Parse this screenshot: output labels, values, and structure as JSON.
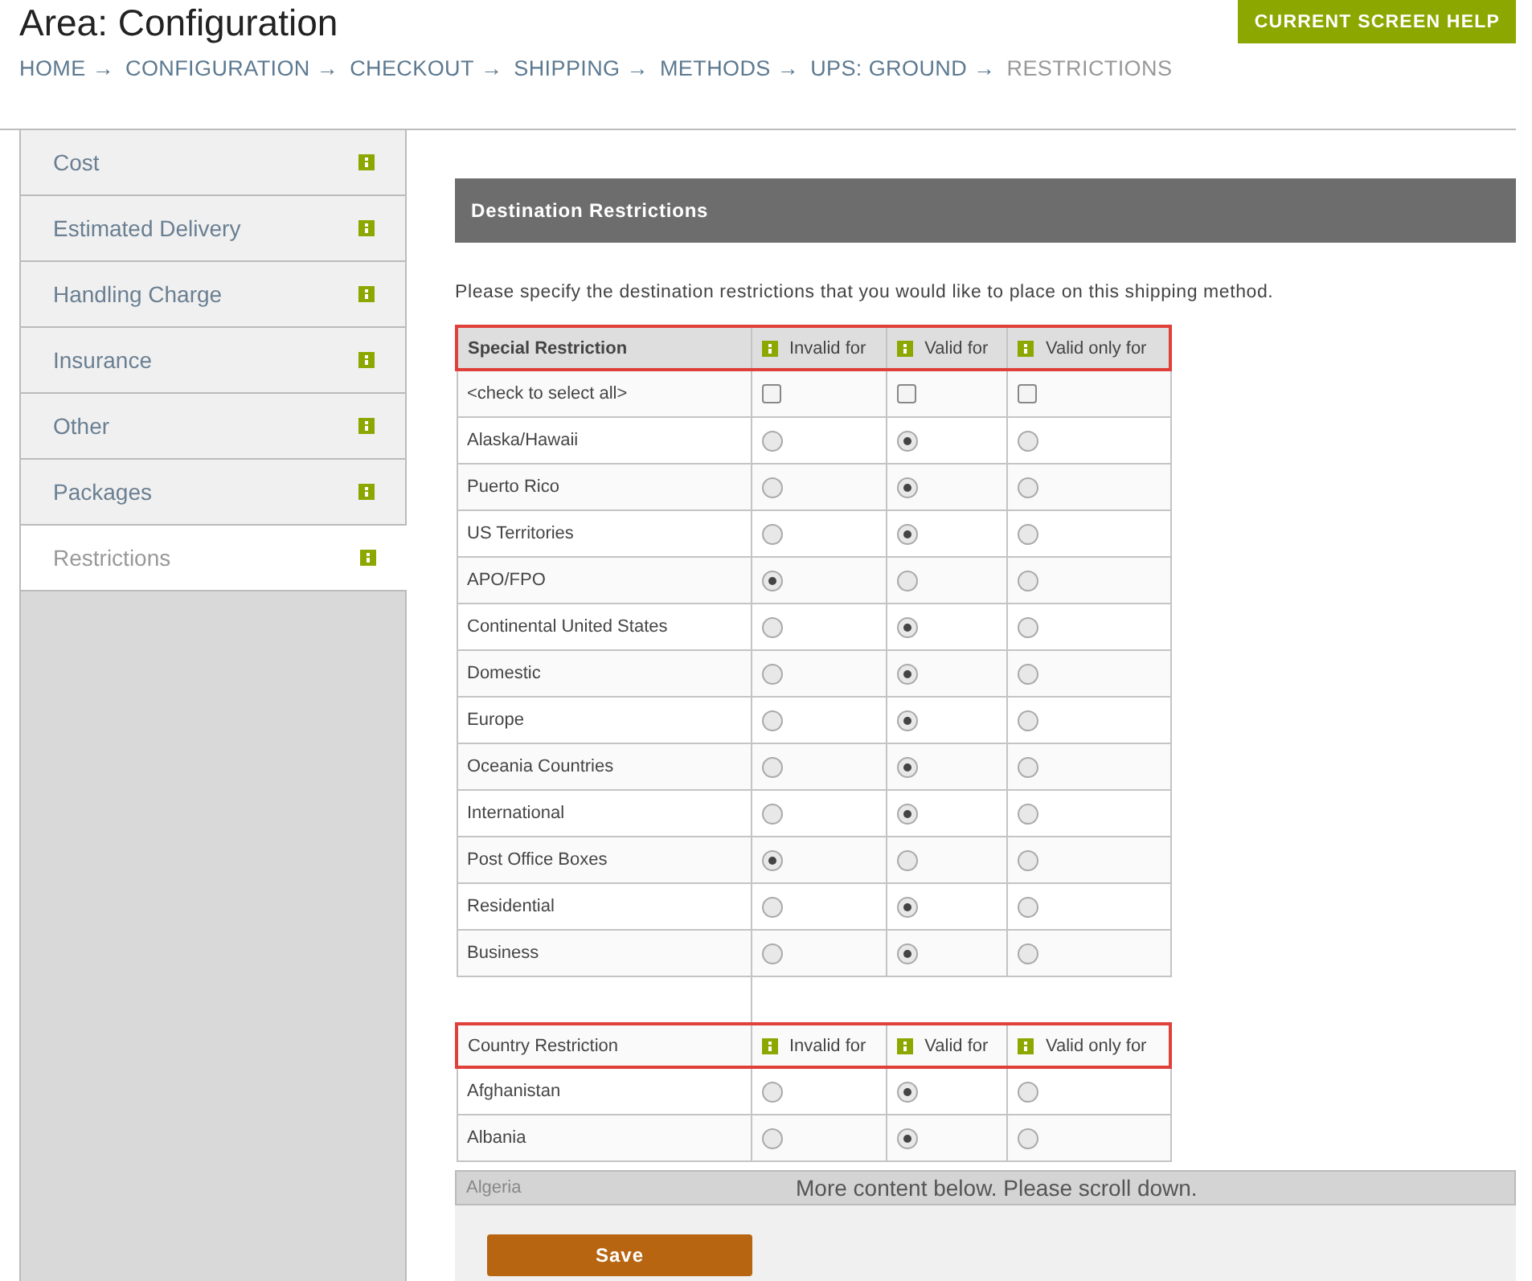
{
  "header": {
    "title": "Area: Configuration",
    "help_button": "CURRENT SCREEN HELP"
  },
  "breadcrumb": [
    {
      "label": "HOME",
      "arrow": "→",
      "current": false
    },
    {
      "label": "CONFIGURATION",
      "arrow": "→",
      "current": false
    },
    {
      "label": "CHECKOUT",
      "arrow": "→",
      "current": false
    },
    {
      "label": "SHIPPING",
      "arrow": "→",
      "current": false
    },
    {
      "label": "METHODS",
      "arrow": "→",
      "current": false
    },
    {
      "label": "UPS: GROUND",
      "arrow": "→",
      "current": false
    },
    {
      "label": "RESTRICTIONS",
      "current": true
    }
  ],
  "sidebar": {
    "items": [
      {
        "label": "Cost",
        "selected": false
      },
      {
        "label": "Estimated Delivery",
        "selected": false
      },
      {
        "label": "Handling Charge",
        "selected": false
      },
      {
        "label": "Insurance",
        "selected": false
      },
      {
        "label": "Other",
        "selected": false
      },
      {
        "label": "Packages",
        "selected": false
      },
      {
        "label": "Restrictions",
        "selected": true
      }
    ]
  },
  "panel": {
    "title": "Destination Restrictions",
    "instructions": "Please specify the destination restrictions that you would like to place on this shipping method."
  },
  "tables": [
    {
      "heading": "Special Restriction",
      "columns": [
        "Invalid for",
        "Valid for",
        "Valid only for"
      ],
      "select_all": {
        "label": "<check to select all>",
        "checked": [
          false,
          false,
          false
        ]
      },
      "rows": [
        {
          "label": "Alaska/Hawaii",
          "radios": [
            false,
            true,
            false
          ]
        },
        {
          "label": "Puerto Rico",
          "radios": [
            false,
            true,
            false
          ]
        },
        {
          "label": "US Territories",
          "radios": [
            false,
            true,
            false
          ]
        },
        {
          "label": "APO/FPO",
          "radios": [
            true,
            false,
            false
          ]
        },
        {
          "label": "Continental United States",
          "radios": [
            false,
            true,
            false
          ]
        },
        {
          "label": "Domestic",
          "radios": [
            false,
            true,
            false
          ]
        },
        {
          "label": "Europe",
          "radios": [
            false,
            true,
            false
          ]
        },
        {
          "label": "Oceania Countries",
          "radios": [
            false,
            true,
            false
          ]
        },
        {
          "label": "International",
          "radios": [
            false,
            true,
            false
          ]
        },
        {
          "label": "Post Office Boxes",
          "radios": [
            true,
            false,
            false
          ]
        },
        {
          "label": "Residential",
          "radios": [
            false,
            true,
            false
          ]
        },
        {
          "label": "Business",
          "radios": [
            false,
            true,
            false
          ]
        }
      ]
    },
    {
      "heading": "Country Restriction",
      "columns": [
        "Invalid for",
        "Valid for",
        "Valid only for"
      ],
      "rows": [
        {
          "label": "Afghanistan",
          "radios": [
            false,
            true,
            false
          ]
        },
        {
          "label": "Albania",
          "radios": [
            false,
            true,
            false
          ]
        }
      ]
    }
  ],
  "footer": {
    "partial_row": "Algeria",
    "notice": "More content below. Please scroll down.",
    "save_button": "Save"
  }
}
